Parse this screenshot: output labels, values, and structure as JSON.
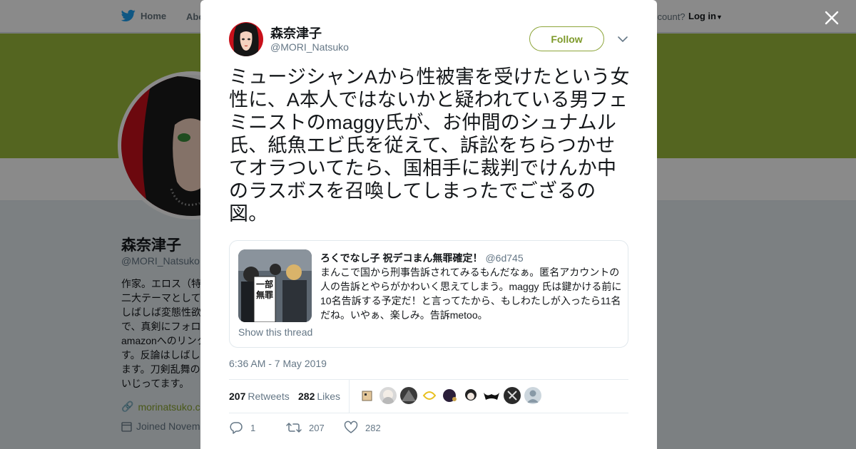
{
  "nav": {
    "home_label": "Home",
    "about_label": "Abo",
    "account_prompt": "ccount?",
    "login_label": "Log in"
  },
  "profile": {
    "name": "森奈津子",
    "handle": "@MORI_Natsuko",
    "bio": "作家。エロス（特\n二大テーマとして\nしばしば変態性欲\nで、真剣にフォロ\namazonへのリンク\nす。反論はしばし\nます。刀剣乱舞の\nいじってます。",
    "link": "morinatsuko.co",
    "joined": "Joined Novem"
  },
  "tweet": {
    "author_name": "森奈津子",
    "author_handle": "@MORI_Natsuko",
    "follow_label": "Follow",
    "text": "ミュージシャンAから性被害を受けたという女性に、A本人ではないかと疑われている男フェミニストのmaggy氏が、お仲間のシュナムル氏、紙魚エビ氏を従えて、訴訟をちらつかせてオラついてたら、国相手に裁判でけんか中のラスボスを召喚してしまったでござるの図。",
    "quote": {
      "author_name": "ろくでなし子 祝デコまん無罪確定！",
      "author_handle": "@6d745",
      "text": "まんこで国から刑事告訴されてみるもんだなぁ。匿名アカウントの人の告訴とやらがかわいく思えてしまう。maggy 氏は鍵かける前に10名告訴する予定だ！と言ってたから、もしわたしが入ったら11名だね。いやぁ、楽しみ。告訴metoo。",
      "show_thread": "Show this thread",
      "image_sign_text": "一部無罪"
    },
    "timestamp": "6:36 AM - 7 May 2019",
    "retweets_count": "207",
    "retweets_label": "Retweets",
    "likes_count": "282",
    "likes_label": "Likes",
    "actions": {
      "reply_count": "1",
      "retweet_count": "207",
      "like_count": "282"
    }
  },
  "colors": {
    "banner": "#9bbb3b",
    "follow_accent": "#7e9a2b",
    "twitter_blue": "#1da1f2"
  }
}
